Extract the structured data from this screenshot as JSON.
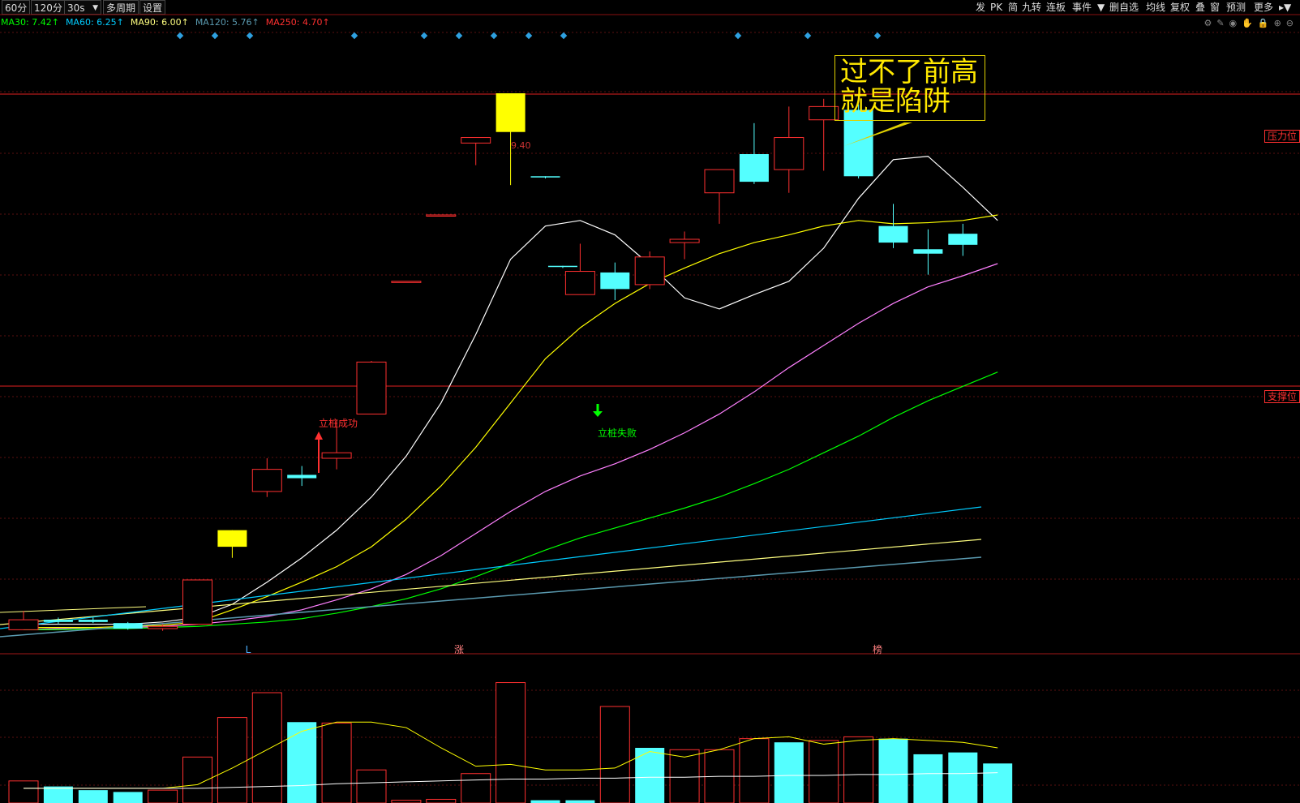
{
  "toolbar": {
    "left": [
      "60分",
      "120分",
      "30s",
      "多周期",
      "设置"
    ],
    "right": [
      "发",
      "PK",
      "简",
      "九转",
      "连板",
      "事件",
      "删自选",
      "均线",
      "复权",
      "叠",
      "窗",
      "预测",
      "更多"
    ]
  },
  "ma_legend": [
    {
      "label": "MA30: 7.42↑",
      "color": "#00ff00"
    },
    {
      "label": "MA60: 6.25↑",
      "color": "#00ccff"
    },
    {
      "label": "MA90: 6.00↑",
      "color": "#ffff80"
    },
    {
      "label": "MA120: 5.76↑",
      "color": "#5a9ab0"
    },
    {
      "label": "MA250: 4.70↑",
      "color": "#ff3030"
    }
  ],
  "icons": [
    "gear-icon",
    "pen-icon",
    "eye-icon",
    "hand-icon",
    "lock-icon",
    "plus-circle-icon",
    "minus-circle-icon"
  ],
  "levels": {
    "resistance": {
      "label": "压力位",
      "price": 9.4
    },
    "support": {
      "label": "支撑位",
      "price": 7.43
    }
  },
  "price_label": "9.40",
  "note": {
    "line1": "过不了前高",
    "line2": "就是陷阱"
  },
  "annotations": {
    "success": "立桩成功",
    "failure": "立桩失败"
  },
  "markers": {
    "l": "L",
    "zhang": "涨",
    "bang": "榜"
  },
  "colors": {
    "up": "#ff3030",
    "down": "#54ffff",
    "limit": "#ffff00",
    "ma5": "#ffffff",
    "ma10": "#ffff00",
    "ma20": "#ff80ff",
    "ma30": "#00ff00",
    "ma60": "#00ccff",
    "ma90": "#ffff80",
    "ma120": "#5a9ab0"
  },
  "chart_data": {
    "type": "candlestick",
    "x": [
      0,
      1,
      2,
      3,
      4,
      5,
      6,
      7,
      8,
      9,
      10,
      11,
      12,
      13,
      14,
      15,
      15.5,
      16,
      17,
      18,
      19,
      20,
      21,
      22,
      23,
      24,
      25,
      26,
      27,
      28
    ],
    "candles": [
      {
        "o": 4.64,
        "h": 4.72,
        "l": 4.55,
        "c": 4.55,
        "dir": "up"
      },
      {
        "o": 4.64,
        "h": 4.66,
        "l": 4.6,
        "c": 4.62,
        "dir": "down"
      },
      {
        "o": 4.64,
        "h": 4.66,
        "l": 4.61,
        "c": 4.62,
        "dir": "down"
      },
      {
        "o": 4.61,
        "h": 4.62,
        "l": 4.55,
        "c": 4.56,
        "dir": "down"
      },
      {
        "o": 4.56,
        "h": 4.6,
        "l": 4.54,
        "c": 4.58,
        "dir": "up"
      },
      {
        "o": 4.6,
        "h": 5.0,
        "l": 4.6,
        "c": 5.0,
        "dir": "up"
      },
      {
        "o": 5.45,
        "h": 5.45,
        "l": 5.2,
        "c": 5.3,
        "dir": "limit"
      },
      {
        "o": 5.8,
        "h": 6.1,
        "l": 5.75,
        "c": 6.0,
        "dir": "up"
      },
      {
        "o": 5.95,
        "h": 6.03,
        "l": 5.85,
        "c": 5.92,
        "dir": "down"
      },
      {
        "o": 6.1,
        "h": 6.45,
        "l": 6.0,
        "c": 6.15,
        "dir": "up"
      },
      {
        "o": 6.5,
        "h": 6.98,
        "l": 6.5,
        "c": 6.97,
        "dir": "up"
      },
      {
        "o": 7.7,
        "h": 7.7,
        "l": 7.7,
        "c": 7.7,
        "dir": "up"
      },
      {
        "o": 8.3,
        "h": 8.3,
        "l": 8.3,
        "c": 8.3,
        "dir": "up"
      },
      {
        "o": 8.95,
        "h": 9.0,
        "l": 8.75,
        "c": 9.0,
        "dir": "up"
      },
      {
        "o": 9.4,
        "h": 9.4,
        "l": 8.57,
        "c": 9.05,
        "dir": "limit"
      },
      {
        "o": 8.65,
        "h": 8.65,
        "l": 8.63,
        "c": 8.64,
        "dir": "down"
      },
      {
        "o": 7.84,
        "h": 7.84,
        "l": 7.82,
        "c": 7.83,
        "dir": "down"
      },
      {
        "o": 7.58,
        "h": 8.04,
        "l": 7.58,
        "c": 7.79,
        "dir": "up"
      },
      {
        "o": 7.78,
        "h": 7.87,
        "l": 7.53,
        "c": 7.63,
        "dir": "down"
      },
      {
        "o": 7.67,
        "h": 7.97,
        "l": 7.63,
        "c": 7.92,
        "dir": "up"
      },
      {
        "o": 8.08,
        "h": 8.15,
        "l": 7.9,
        "c": 8.05,
        "dir": "up"
      },
      {
        "o": 8.5,
        "h": 8.5,
        "l": 8.22,
        "c": 8.71,
        "dir": "up"
      },
      {
        "o": 8.85,
        "h": 9.13,
        "l": 8.58,
        "c": 8.6,
        "dir": "down"
      },
      {
        "o": 8.71,
        "h": 9.28,
        "l": 8.5,
        "c": 9.0,
        "dir": "up"
      },
      {
        "o": 9.16,
        "h": 9.35,
        "l": 8.7,
        "c": 9.28,
        "dir": "up"
      },
      {
        "o": 9.25,
        "h": 9.3,
        "l": 8.63,
        "c": 8.65,
        "dir": "down"
      },
      {
        "o": 8.2,
        "h": 8.4,
        "l": 8.0,
        "c": 8.05,
        "dir": "down"
      },
      {
        "o": 7.99,
        "h": 8.17,
        "l": 7.76,
        "c": 7.95,
        "dir": "down"
      },
      {
        "o": 8.13,
        "h": 8.22,
        "l": 7.93,
        "c": 8.03,
        "dir": "down"
      }
    ],
    "ma_lines": {
      "ma5": [
        4.6,
        4.6,
        4.6,
        4.6,
        4.62,
        4.66,
        4.78,
        4.98,
        5.2,
        5.45,
        5.75,
        6.12,
        6.6,
        7.22,
        7.9,
        8.2,
        8.25,
        8.12,
        7.85,
        7.55,
        7.45,
        7.58,
        7.7,
        8.0,
        8.45,
        8.8,
        8.83,
        8.55,
        8.25
      ],
      "ma10": [
        4.57,
        4.57,
        4.57,
        4.58,
        4.59,
        4.62,
        4.73,
        4.85,
        4.98,
        5.12,
        5.3,
        5.55,
        5.85,
        6.2,
        6.6,
        7.0,
        7.28,
        7.5,
        7.68,
        7.82,
        7.95,
        8.05,
        8.12,
        8.2,
        8.25,
        8.22,
        8.23,
        8.25,
        8.3
      ],
      "ma20": [
        4.55,
        4.56,
        4.56,
        4.57,
        4.58,
        4.6,
        4.63,
        4.67,
        4.73,
        4.82,
        4.92,
        5.05,
        5.22,
        5.42,
        5.62,
        5.8,
        5.94,
        6.05,
        6.18,
        6.33,
        6.5,
        6.7,
        6.92,
        7.12,
        7.32,
        7.5,
        7.65,
        7.75,
        7.86
      ],
      "ma30": [
        4.55,
        4.55,
        4.56,
        4.56,
        4.57,
        4.58,
        4.6,
        4.62,
        4.65,
        4.7,
        4.76,
        4.83,
        4.92,
        5.03,
        5.15,
        5.27,
        5.38,
        5.47,
        5.56,
        5.65,
        5.75,
        5.87,
        6.0,
        6.15,
        6.3,
        6.47,
        6.62,
        6.75,
        6.88
      ]
    },
    "price_axis": {
      "min": 4.45,
      "max": 9.95
    },
    "volume": [
      {
        "v": 24,
        "dir": "up"
      },
      {
        "v": 18,
        "dir": "down"
      },
      {
        "v": 14,
        "dir": "down"
      },
      {
        "v": 12,
        "dir": "down"
      },
      {
        "v": 14,
        "dir": "up"
      },
      {
        "v": 50,
        "dir": "up"
      },
      {
        "v": 93,
        "dir": "up"
      },
      {
        "v": 120,
        "dir": "up"
      },
      {
        "v": 88,
        "dir": "down"
      },
      {
        "v": 87,
        "dir": "up"
      },
      {
        "v": 36,
        "dir": "up"
      },
      {
        "v": 3,
        "dir": "up"
      },
      {
        "v": 4,
        "dir": "up"
      },
      {
        "v": 32,
        "dir": "up"
      },
      {
        "v": 131,
        "dir": "up"
      },
      {
        "v": 3,
        "dir": "down"
      },
      {
        "v": 3,
        "dir": "down"
      },
      {
        "v": 105,
        "dir": "up"
      },
      {
        "v": 60,
        "dir": "down"
      },
      {
        "v": 58,
        "dir": "up"
      },
      {
        "v": 58,
        "dir": "up"
      },
      {
        "v": 70,
        "dir": "up"
      },
      {
        "v": 66,
        "dir": "down"
      },
      {
        "v": 68,
        "dir": "up"
      },
      {
        "v": 72,
        "dir": "up"
      },
      {
        "v": 70,
        "dir": "down"
      },
      {
        "v": 53,
        "dir": "down"
      },
      {
        "v": 55,
        "dir": "down"
      },
      {
        "v": 43,
        "dir": "down"
      }
    ],
    "volume_ma": {
      "ma5": [
        16,
        16,
        16,
        16,
        16,
        20,
        38,
        58,
        78,
        88,
        88,
        82,
        60,
        40,
        42,
        36,
        36,
        38,
        56,
        50,
        58,
        70,
        72,
        64,
        68,
        70,
        68,
        66,
        60
      ],
      "ma10": [
        16,
        16,
        16,
        16,
        16,
        16,
        17,
        18,
        19,
        21,
        22,
        23,
        24,
        25,
        26,
        26,
        27,
        27,
        28,
        28,
        29,
        29,
        30,
        30,
        31,
        31,
        32,
        32,
        33
      ]
    }
  }
}
